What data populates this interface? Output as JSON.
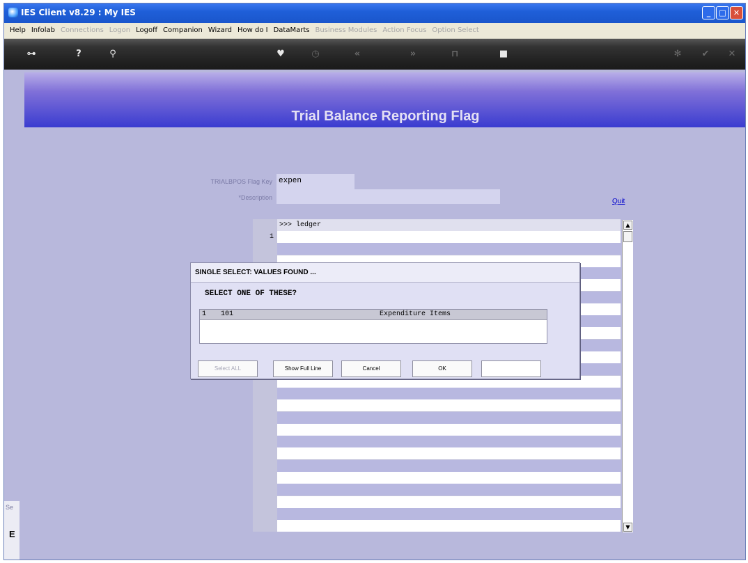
{
  "window": {
    "title": "IES Client v8.29 : My IES"
  },
  "menu": {
    "items": [
      {
        "label": "Help",
        "enabled": true
      },
      {
        "label": "Infolab",
        "enabled": true
      },
      {
        "label": "Connections",
        "enabled": false
      },
      {
        "label": "Logon",
        "enabled": false
      },
      {
        "label": "Logoff",
        "enabled": true
      },
      {
        "label": "Companion",
        "enabled": true
      },
      {
        "label": "Wizard",
        "enabled": true
      },
      {
        "label": "How do I",
        "enabled": true
      },
      {
        "label": "DataMarts",
        "enabled": true
      },
      {
        "label": "Business Modules",
        "enabled": false
      },
      {
        "label": "Action Focus",
        "enabled": false
      },
      {
        "label": "Option Select",
        "enabled": false
      }
    ]
  },
  "toolbar": {
    "icons": [
      "key-icon",
      "help-icon",
      "search-icon",
      "heart-icon",
      "clock-icon",
      "rewind-icon",
      "fast-forward-icon",
      "tag-icon",
      "stop-icon",
      "settings-icon",
      "check-icon",
      "close-icon"
    ]
  },
  "banner": {
    "title": "Trial Balance Reporting Flag"
  },
  "form": {
    "flagkey_label": "TRIALBPOS Flag Key",
    "flagkey_value": "expen",
    "description_label": "*Description",
    "description_value": "",
    "quit_label": "Quit"
  },
  "list": {
    "header": ">>> ledger",
    "first_row_number": "1"
  },
  "dialog": {
    "title": "SINGLE SELECT: VALUES FOUND ...",
    "prompt": "SELECT ONE OF THESE?",
    "rows": [
      {
        "num": "1",
        "code": "101",
        "desc": "Expenditure Items"
      }
    ],
    "buttons": {
      "select_all": "Select ALL",
      "show_full_line": "Show Full Line",
      "cancel": "Cancel",
      "ok": "OK"
    },
    "input_value": ""
  },
  "sidepanel": {
    "label_top": "Se",
    "label_bottom": "E"
  }
}
